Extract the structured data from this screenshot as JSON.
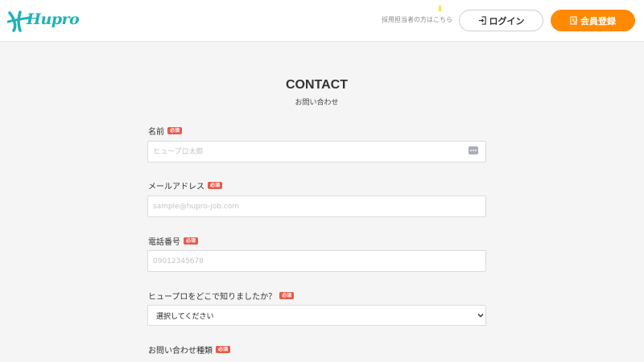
{
  "header": {
    "logo_text": "Hupro",
    "recruiter_link": "採用担当者の方はこちら",
    "login_label": "ログイン",
    "register_label": "会員登録",
    "colors": {
      "brand": "#1fb2b8",
      "accent": "#ff8a00",
      "required": "#e8594a"
    }
  },
  "page": {
    "title": "CONTACT",
    "subtitle": "お問い合わせ"
  },
  "form": {
    "required_badge": "必須",
    "name": {
      "label": "名前",
      "placeholder": "ヒュープロ太郎",
      "value": ""
    },
    "email": {
      "label": "メールアドレス",
      "placeholder": "sample@hupro-job.com",
      "value": ""
    },
    "phone": {
      "label": "電話番号",
      "placeholder": "09012345678",
      "value": ""
    },
    "source": {
      "label": "ヒュープロをどこで知りましたか？",
      "selected": "選択してください"
    },
    "inquiry_type": {
      "label": "お問い合わせ種類"
    }
  },
  "icons": {
    "logo": "hupro-logo-icon",
    "login": "login-icon",
    "register": "register-icon",
    "autofill": "more-icon",
    "chevron": "chevron-down-icon"
  }
}
